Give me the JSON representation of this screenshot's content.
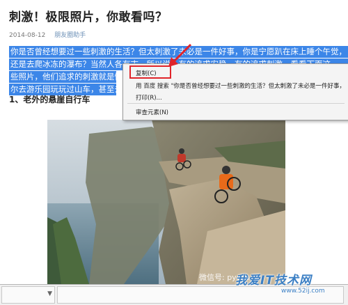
{
  "article": {
    "title": "刺激！极限照片，你敢看吗？",
    "date": "2014-08-12",
    "author": "朋友圈助手",
    "selected_lines": [
      "你是否曾经想要过一些刺激的生活？但太刺激了未必是一件好事，你是宁愿趴在床上睡个午觉，",
      "还是去爬冰冻的瀑布？当然人各有志，所以说，有的追求安稳，有的追求刺激，看看下面这",
      "些照片，他们追求的刺激就是惊心",
      "尔去游乐园玩玩过山车，甚至去玩"
    ],
    "sub_heading": "1、老外的悬崖自行车"
  },
  "context_menu": {
    "copy": "复制(C)",
    "search": "用 百度 搜索 \"你是否曾经想要过一些刺激的生活？但太刺激了未必是一件好事，你是宁\"",
    "print": "打印(R)...",
    "inspect": "审查元素(N)"
  },
  "watermark": {
    "brand": "我爱IT技术网",
    "url": "www.52ij.com",
    "baidu": "微信号: pyqzs"
  },
  "status_bar": {
    "arrow": "▼"
  },
  "colors": {
    "selection": "#3c86e8",
    "highlight_box": "#e0242a",
    "watermark": "#3b7fc4"
  }
}
